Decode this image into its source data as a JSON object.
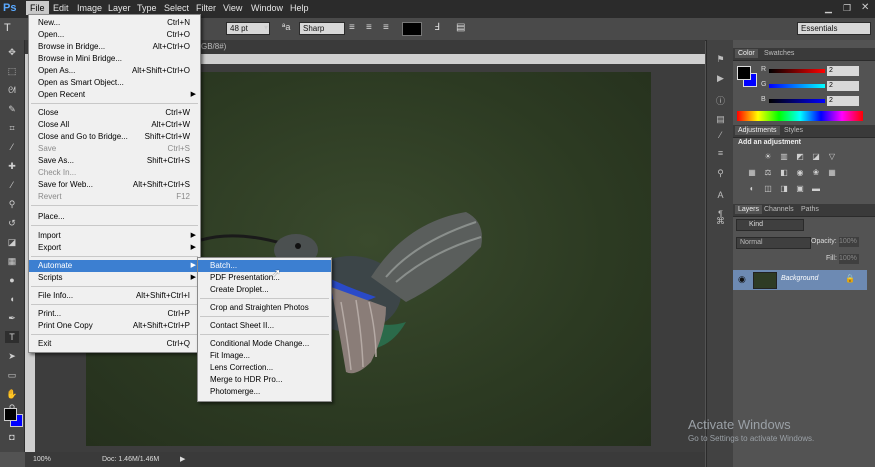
{
  "app": {
    "logo": "Ps"
  },
  "menubar": {
    "items": [
      "File",
      "Edit",
      "Image",
      "Layer",
      "Type",
      "Select",
      "Filter",
      "View",
      "Window",
      "Help"
    ]
  },
  "options": {
    "font_size": "48 pt",
    "antialias": "Sharp",
    "workspace": "Essentials",
    "doc_tab_suffix": "GB/8#)"
  },
  "file_menu": [
    {
      "label": "New...",
      "shortcut": "Ctrl+N"
    },
    {
      "label": "Open...",
      "shortcut": "Ctrl+O"
    },
    {
      "label": "Browse in Bridge...",
      "shortcut": "Alt+Ctrl+O"
    },
    {
      "label": "Browse in Mini Bridge...",
      "shortcut": ""
    },
    {
      "label": "Open As...",
      "shortcut": "Alt+Shift+Ctrl+O"
    },
    {
      "label": "Open as Smart Object...",
      "shortcut": ""
    },
    {
      "label": "Open Recent",
      "shortcut": ""
    },
    {
      "label": "Close",
      "shortcut": "Ctrl+W"
    },
    {
      "label": "Close All",
      "shortcut": "Alt+Ctrl+W"
    },
    {
      "label": "Close and Go to Bridge...",
      "shortcut": "Shift+Ctrl+W"
    },
    {
      "label": "Save",
      "shortcut": "Ctrl+S"
    },
    {
      "label": "Save As...",
      "shortcut": "Shift+Ctrl+S"
    },
    {
      "label": "Check In...",
      "shortcut": ""
    },
    {
      "label": "Save for Web...",
      "shortcut": "Alt+Shift+Ctrl+S"
    },
    {
      "label": "Revert",
      "shortcut": "F12"
    },
    {
      "label": "Place...",
      "shortcut": ""
    },
    {
      "label": "Import",
      "shortcut": ""
    },
    {
      "label": "Export",
      "shortcut": ""
    },
    {
      "label": "Automate",
      "shortcut": ""
    },
    {
      "label": "Scripts",
      "shortcut": ""
    },
    {
      "label": "File Info...",
      "shortcut": "Alt+Shift+Ctrl+I"
    },
    {
      "label": "Print...",
      "shortcut": "Ctrl+P"
    },
    {
      "label": "Print One Copy",
      "shortcut": "Alt+Shift+Ctrl+P"
    },
    {
      "label": "Exit",
      "shortcut": "Ctrl+Q"
    }
  ],
  "automate_menu": [
    "Batch...",
    "PDF Presentation...",
    "Create Droplet...",
    "Crop and Straighten Photos",
    "Contact Sheet II...",
    "Conditional Mode Change...",
    "Fit Image...",
    "Lens Correction...",
    "Merge to HDR Pro...",
    "Photomerge..."
  ],
  "color_panel": {
    "tabs": [
      "Color",
      "Swatches"
    ],
    "r_label": "R",
    "g_label": "G",
    "b_label": "B",
    "r": "2",
    "g": "2",
    "b": "2"
  },
  "adjustments_panel": {
    "tabs": [
      "Adjustments",
      "Styles"
    ],
    "heading": "Add an adjustment"
  },
  "layers_panel": {
    "tabs": [
      "Layers",
      "Channels",
      "Paths"
    ],
    "kind": "Kind",
    "blend": "Normal",
    "opacity_label": "Opacity:",
    "opacity": "100%",
    "fill_label": "Fill:",
    "fill": "100%",
    "layer_name": "Background"
  },
  "status": {
    "zoom": "100%",
    "doc": "Doc: 1.46M/1.46M"
  },
  "activation": {
    "title": "Activate Windows",
    "subtitle": "Go to Settings to activate Windows."
  },
  "colors": {
    "highlight": "#3c7fd1",
    "foreground": "#000000",
    "background": "#0000ff"
  }
}
